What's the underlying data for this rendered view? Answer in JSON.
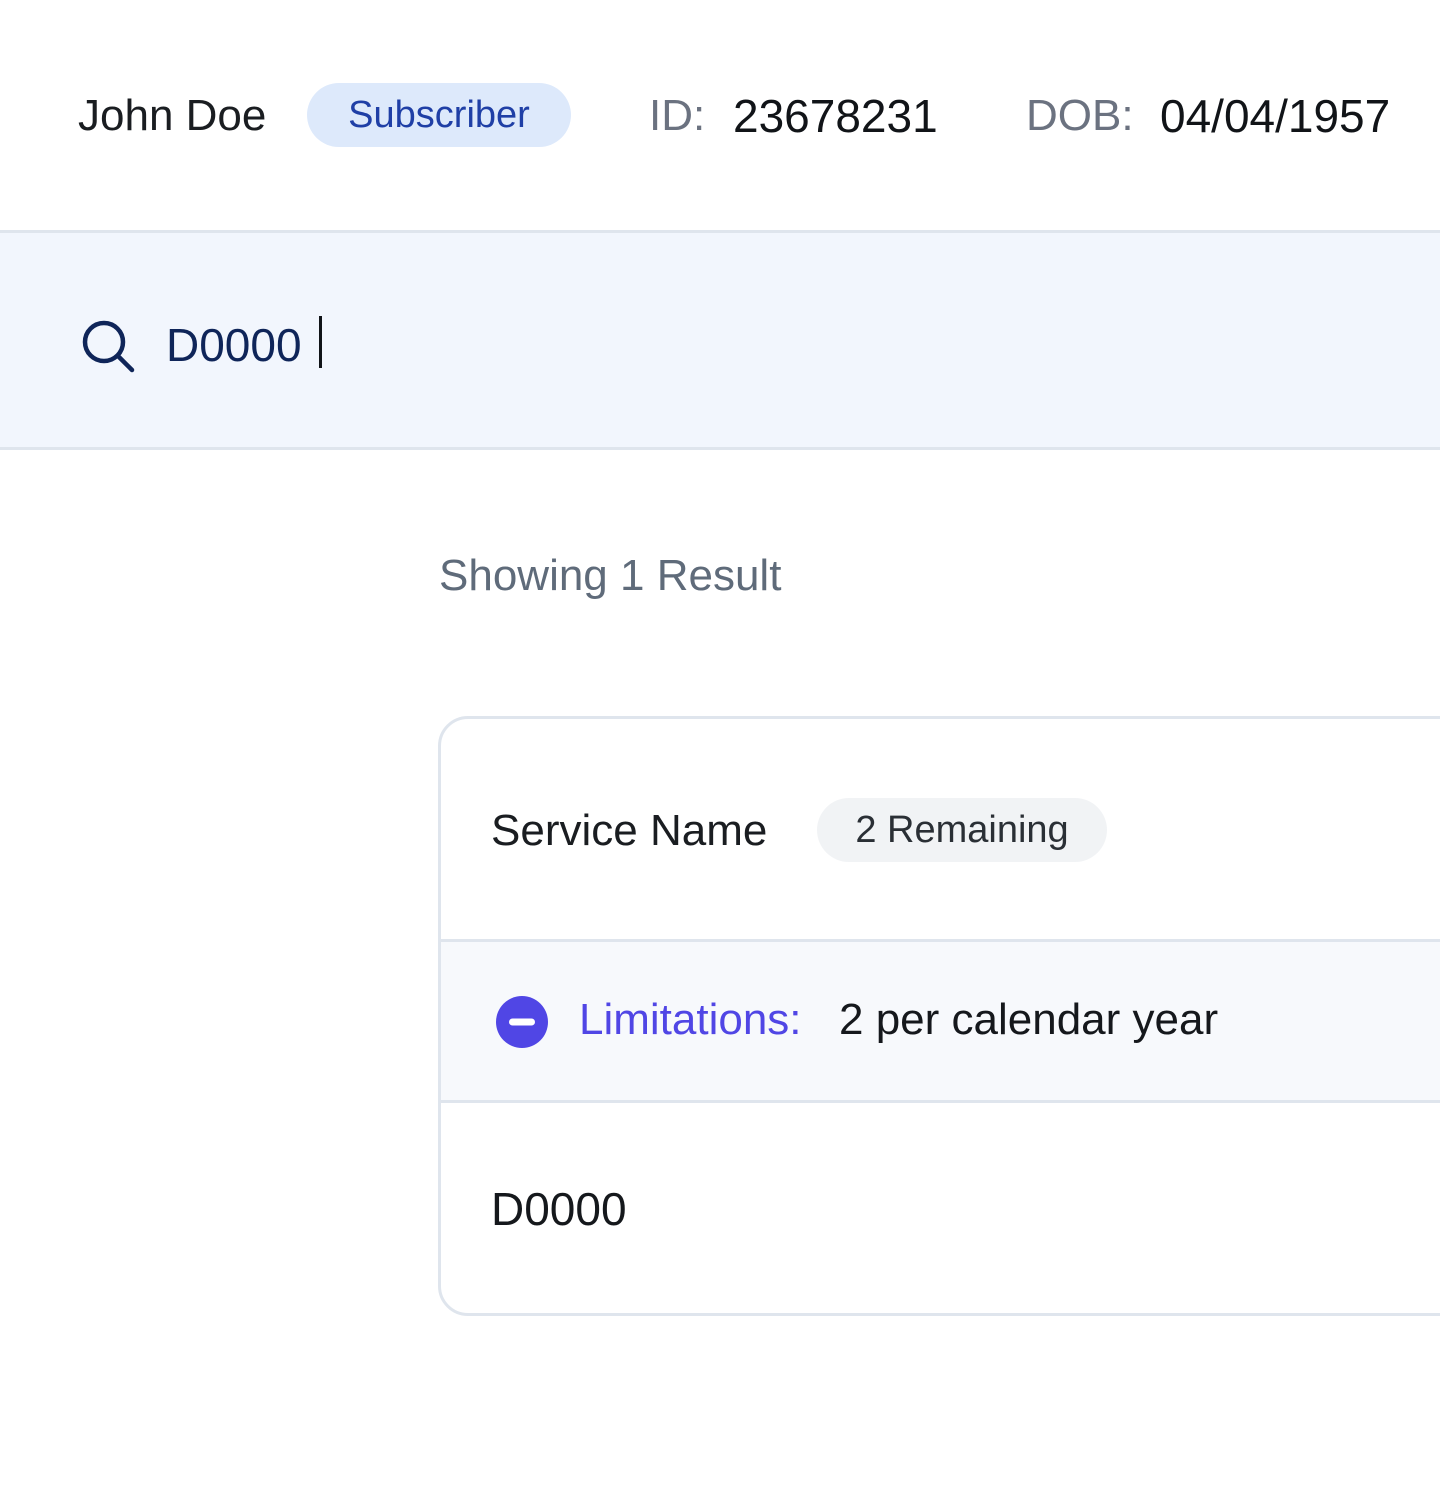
{
  "header": {
    "member_name": "John Doe",
    "role_badge": "Subscriber",
    "id_label": "ID:",
    "id_value": "23678231",
    "dob_label": "DOB:",
    "dob_value": "04/04/1957"
  },
  "search": {
    "value": "D0000",
    "icon": "search-icon"
  },
  "results": {
    "count_text": "Showing 1 Result",
    "items": [
      {
        "service_name": "Service Name",
        "remaining_badge": "2 Remaining",
        "limitations_label": "Limitations:",
        "limitations_value": "2 per calendar year",
        "limitations_icon": "minus-circle-icon",
        "code": "D0000"
      }
    ]
  },
  "colors": {
    "accent": "#5046e5",
    "badge_bg": "#dde9fb",
    "badge_text": "#1f3fa6",
    "search_bg": "#f2f6fd"
  }
}
